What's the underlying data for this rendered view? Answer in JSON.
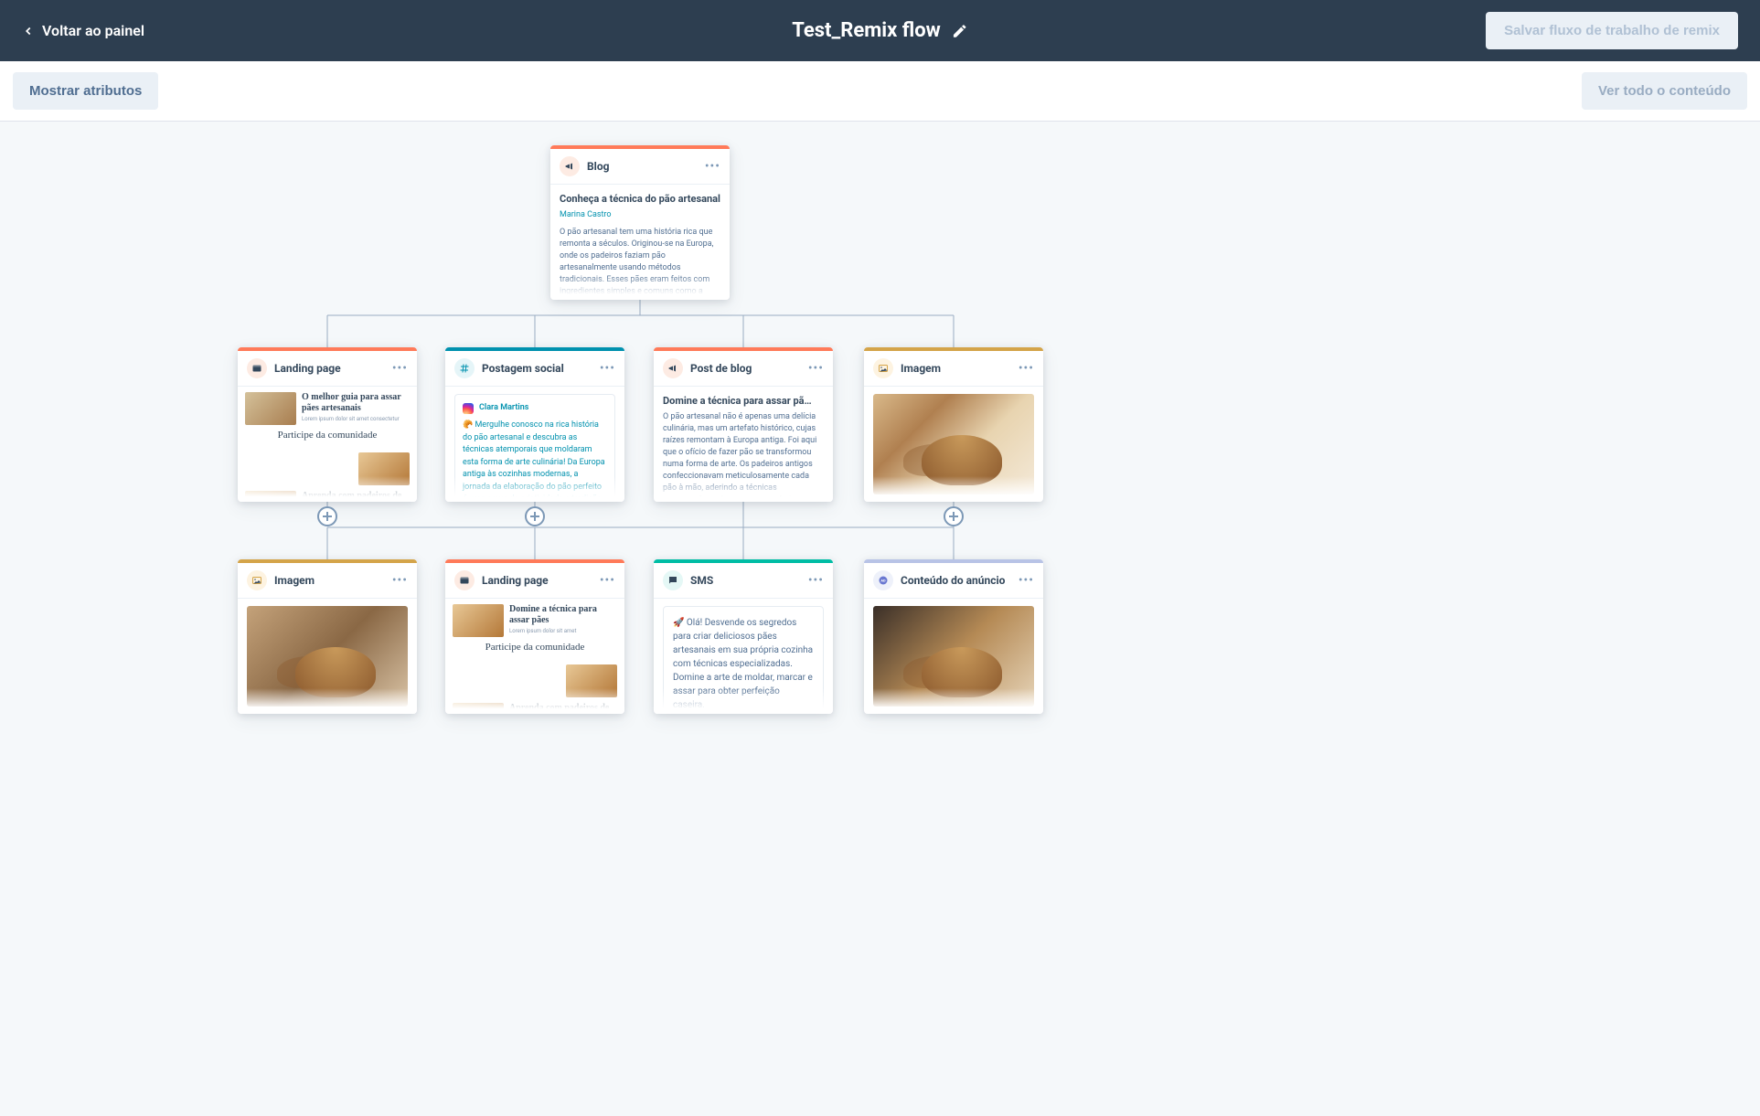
{
  "header": {
    "back_label": "Voltar ao painel",
    "title": "Test_Remix flow",
    "save_label": "Salvar fluxo de trabalho de remix"
  },
  "toolbar": {
    "show_attrs": "Mostrar atributos",
    "view_all": "Ver todo o conteúdo"
  },
  "colors": {
    "orange": "#ff7a59",
    "blue": "#0091ae",
    "amber": "#d4a449",
    "teal": "#00a4bd",
    "teal_dark": "#00bda5",
    "lilac": "#b8c3e6"
  },
  "root": {
    "type": "Blog",
    "title": "Conheça a técnica do pão artesanal",
    "author": "Marina Castro",
    "text": "O pão artesanal tem uma história rica que remonta a séculos. Originou-se na Europa, onde os padeiros faziam pão artesanalmente usando métodos tradicionais. Esses pães eram feitos com ingredientes simples e comuns como a farinha."
  },
  "row1": [
    {
      "type": "Landing page",
      "accent": "orange",
      "lp_title1": "O melhor guia para assar pães artesanais",
      "lp_heading": "Participe da comunidade",
      "lp_title2": "Aprenda com padeiros de renome mundial"
    },
    {
      "type": "Postagem social",
      "accent": "blue",
      "social_name": "Clara Martins",
      "social_text": "🥐 Mergulhe conosco na rica história do pão artesanal e descubra as técnicas atemporais que moldaram esta forma de arte culinária! Da Europa antiga às cozinhas modernas, a jornada da elaboração do pão perfeito é uma prova da criatividade e tradição humanas. 🍞🔥 #PaoArtesanal #HistoriaDoPao"
    },
    {
      "type": "Post de blog",
      "accent": "orange",
      "title": "Domine a técnica para assar pã…",
      "text": "O pão artesanal não é apenas uma delícia culinária, mas um artefato histórico, cujas raízes remontam à Europa antiga. Foi aqui que o ofício de fazer pão se transformou numa forma de arte. Os padeiros antigos confeccionavam meticulosamente cada pão à mão, aderindo a técnicas consagradas pelo tempo que valorizavam a simplicidade e a"
    },
    {
      "type": "Imagem",
      "accent": "amber"
    }
  ],
  "row2": [
    {
      "type": "Imagem",
      "accent": "amber"
    },
    {
      "type": "Landing page",
      "accent": "orange",
      "lp_title1": "Domine a técnica para assar pães",
      "lp_heading": "Participe da comunidade",
      "lp_title2": "Aprenda com padeiros de renome mundial"
    },
    {
      "type": "SMS",
      "accent": "teal_dark",
      "text": "🚀 Olá! Desvende os segredos para criar deliciosos pães artesanais em sua própria cozinha com técnicas especializadas. Domine a arte de moldar, marcar e assar para obter perfeição caseira."
    },
    {
      "type": "Conteúdo do anúncio",
      "accent": "lilac"
    }
  ]
}
